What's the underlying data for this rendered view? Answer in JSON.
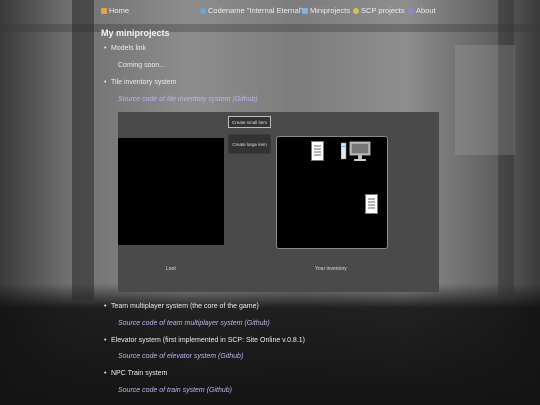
{
  "nav": {
    "home": "Home",
    "internal_eternal": "Codename \"Internal Eternal\"",
    "miniprojects": "Miniprojects",
    "scp_projects": "SCP projects",
    "about": "About"
  },
  "page_title": "My miniprojects",
  "items": {
    "models": "Models link",
    "coming_soon": "Coming soon...",
    "tile_inventory": "Tile inventory system",
    "tile_inventory_src": "Source code of tile inventory system (Github)",
    "team_multiplayer": "Team multiplayer system (the core of the game)",
    "team_multiplayer_src": "Source code of team multiplayer system (Github)",
    "elevator": "Elevator system (first implemented in SCP: Site Online v.0.8.1)",
    "elevator_src": "Source code of elevator system (Github)",
    "npc_train": "NPC Train system",
    "npc_train_src": "Source code of train system (Github)"
  },
  "demo": {
    "create_small_item": "Create small item",
    "create_large_item": "Create large item",
    "loot_label": "Loot",
    "inventory_label": "Your inventory"
  }
}
